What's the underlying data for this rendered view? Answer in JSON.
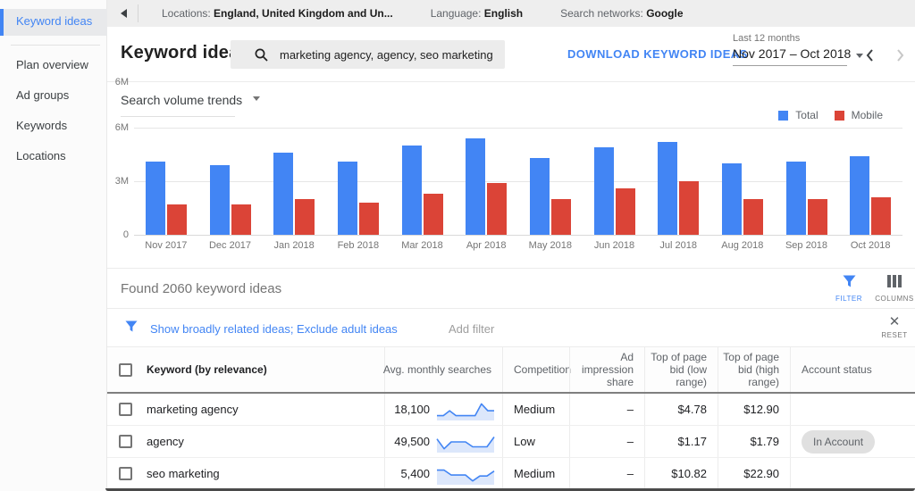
{
  "sidebar": {
    "active_item": "Keyword ideas",
    "items": [
      {
        "label": "Plan overview"
      },
      {
        "label": "Ad groups"
      },
      {
        "label": "Keywords"
      },
      {
        "label": "Locations"
      }
    ]
  },
  "topbar": {
    "locations_label": "Locations:",
    "locations_value": "England, United Kingdom and Un...",
    "language_label": "Language:",
    "language_value": "English",
    "networks_label": "Search networks:",
    "networks_value": "Google"
  },
  "header": {
    "title": "Keyword ideas",
    "search_value": "marketing agency, agency, seo marketing",
    "download_label": "DOWNLOAD KEYWORD IDEAS",
    "range_caption": "Last 12 months",
    "range_value": "Nov 2017 – Oct 2018"
  },
  "chart_section": {
    "dropdown_label": "Search volume trends",
    "legend": [
      {
        "label": "Total",
        "color": "#4285F4"
      },
      {
        "label": "Mobile",
        "color": "#DB4437"
      }
    ]
  },
  "chart_data": {
    "type": "bar",
    "title": "Search volume trends",
    "categories": [
      "Nov 2017",
      "Dec 2017",
      "Jan 2018",
      "Feb 2018",
      "Mar 2018",
      "Apr 2018",
      "May 2018",
      "Jun 2018",
      "Jul 2018",
      "Aug 2018",
      "Sep 2018",
      "Oct 2018"
    ],
    "series": [
      {
        "name": "Total",
        "color": "#4285F4",
        "values": [
          4.1,
          3.9,
          4.6,
          4.1,
          5.0,
          5.4,
          4.3,
          4.9,
          5.2,
          4.0,
          4.1,
          4.4
        ]
      },
      {
        "name": "Mobile",
        "color": "#DB4437",
        "values": [
          1.7,
          1.7,
          2.0,
          1.8,
          2.3,
          2.9,
          2.0,
          2.6,
          3.0,
          2.0,
          2.0,
          2.1
        ]
      }
    ],
    "unit": "millions of monthly searches",
    "ylabel": "",
    "xlabel": "",
    "ylim": [
      0,
      6
    ],
    "y_ticks": [
      "6M",
      "3M",
      "0"
    ],
    "grid": true,
    "legend_position": "top-right"
  },
  "results_bar": {
    "found_text": "Found 2060 keyword ideas",
    "filter_label": "FILTER",
    "columns_label": "COLUMNS"
  },
  "filter_bar": {
    "applied_filters": "Show broadly related ideas; Exclude adult ideas",
    "add_filter_label": "Add filter",
    "reset_label": "RESET"
  },
  "table": {
    "headers": [
      "Keyword (by relevance)",
      "Avg. monthly searches",
      "Competition",
      "Ad impression share",
      "Top of page bid (low range)",
      "Top of page bid (high range)",
      "Account status"
    ],
    "rows": [
      {
        "keyword": "marketing agency",
        "avg_monthly_searches": "18,100",
        "trend": [
          2,
          2,
          4.5,
          2,
          2,
          2,
          2,
          8,
          4.5,
          4.5
        ],
        "competition": "Medium",
        "ad_impression_share": "–",
        "bid_low": "$4.78",
        "bid_high": "$12.90",
        "account_status": ""
      },
      {
        "keyword": "agency",
        "avg_monthly_searches": "49,500",
        "trend": [
          6.5,
          1.5,
          5,
          5,
          5,
          2.5,
          2.5,
          2.5,
          7.5
        ],
        "competition": "Low",
        "ad_impression_share": "–",
        "bid_low": "$1.17",
        "bid_high": "$1.79",
        "account_status": "In Account"
      },
      {
        "keyword": "seo marketing",
        "avg_monthly_searches": "5,400",
        "trend": [
          7,
          7,
          4.5,
          4.5,
          4.5,
          1.5,
          4,
          4,
          6.5
        ],
        "competition": "Medium",
        "ad_impression_share": "–",
        "bid_low": "$10.82",
        "bid_high": "$22.90",
        "account_status": ""
      }
    ]
  },
  "icons": {
    "collapse-panel": "left-triangle",
    "search": "magnifier",
    "dropdown": "caret-down",
    "prev": "chevron-left",
    "next": "chevron-right",
    "filter": "funnel",
    "columns": "three-vertical-bars",
    "reset": "x-cross"
  },
  "colors": {
    "accent_blue": "#4285F4",
    "series_red": "#DB4437",
    "topbar_bg": "#eeeeee",
    "chip_bg": "#e0e0e0"
  }
}
